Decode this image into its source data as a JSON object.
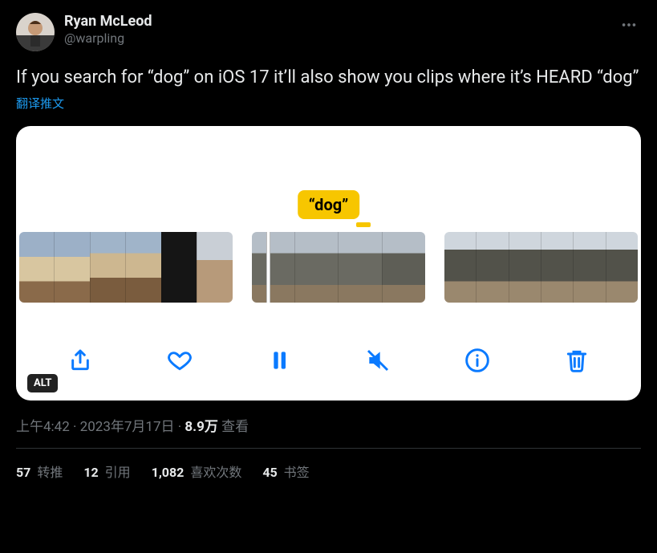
{
  "author": {
    "display_name": "Ryan McLeod",
    "handle": "@warpling"
  },
  "tweet_text": "If you search for “dog” on iOS 17 it’ll also show you clips where it’s HEARD “dog”",
  "translate_label": "翻译推文",
  "media": {
    "caption_badge": "“dog”",
    "alt_badge": "ALT"
  },
  "meta": {
    "time": "上午4:42",
    "date": "2023年7月17日",
    "views_count": "8.9万",
    "views_label": " 查看",
    "dot1": " · ",
    "dot2": " · "
  },
  "stats": {
    "retweets_count": "57",
    "retweets_label": " 转推",
    "quotes_count": "12",
    "quotes_label": " 引用",
    "likes_count": "1,082",
    "likes_label": " 喜欢次数",
    "bookmarks_count": "45",
    "bookmarks_label": " 书签"
  }
}
